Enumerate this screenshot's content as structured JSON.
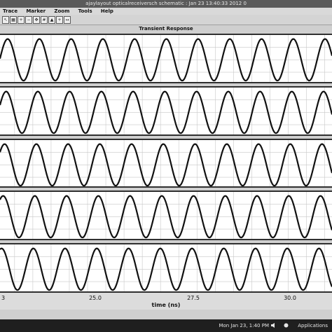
{
  "window": {
    "title": "ajaylayout opticalreceiversch schematic : Jan 23 13:40:33 2012 0"
  },
  "menu": [
    "Trace",
    "Marker",
    "Zoom",
    "Tools",
    "Help"
  ],
  "toolbar_icons": [
    "cursor-icon",
    "zoom-fit-icon",
    "zoom-in-icon",
    "zoom-out-icon",
    "pan-icon",
    "grid-icon",
    "marker-icon",
    "crosshair-icon",
    "arrow-icon"
  ],
  "plot": {
    "title": "Transient Response",
    "xlabel": "time (ns)",
    "ticks": [
      "25.0",
      "27.5",
      "30.0"
    ],
    "tick_values": [
      25.0,
      27.5,
      30.0
    ],
    "edge_tick": "3"
  },
  "chart_data": {
    "type": "line",
    "x_unit": "time (ns)",
    "xlim": [
      22.6,
      31.7
    ],
    "x_ticks": [
      25.0,
      27.5,
      30.0
    ],
    "grid": true,
    "series": [
      {
        "waveform": "sine",
        "period_ns": 0.87,
        "phase": 0.2
      },
      {
        "waveform": "sine",
        "period_ns": 0.87,
        "phase": 0.5
      },
      {
        "waveform": "sine",
        "period_ns": 0.87,
        "phase": 0.8
      },
      {
        "waveform": "sine",
        "period_ns": 0.87,
        "phase": 1.1
      },
      {
        "waveform": "sine",
        "period_ns": 0.87,
        "phase": 1.4
      }
    ]
  },
  "status": {
    "clock": "Mon Jan 23,  1:40 PM",
    "apps": "Applications"
  },
  "colors": {
    "trace": "#111111",
    "grid": "#c8c8c8",
    "background": "#ffffff"
  }
}
